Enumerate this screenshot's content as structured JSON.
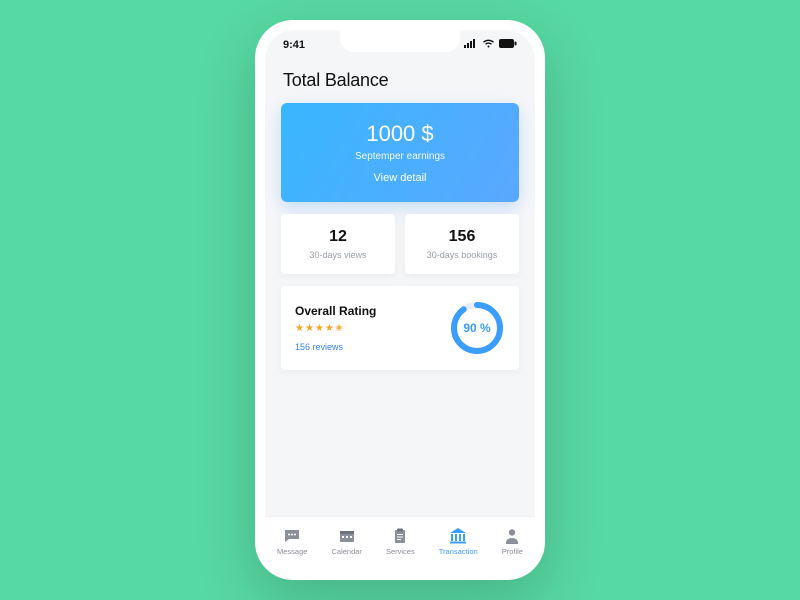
{
  "status": {
    "time": "9:41"
  },
  "page": {
    "title": "Total Balance"
  },
  "balance": {
    "amount": "1000 $",
    "subtitle": "Septemper earnings",
    "cta": "View detail"
  },
  "stats": {
    "views": {
      "value": "12",
      "label": "30-days views"
    },
    "bookings": {
      "value": "156",
      "label": "30-days bookings"
    }
  },
  "rating": {
    "title": "Overall Rating",
    "stars": "★★★★✬",
    "reviews": "156 reviews",
    "percent_label": "90 %",
    "percent": 90
  },
  "tabs": {
    "message": "Message",
    "calendar": "Calendar",
    "services": "Services",
    "transaction": "Transaction",
    "profile": "Profile"
  }
}
